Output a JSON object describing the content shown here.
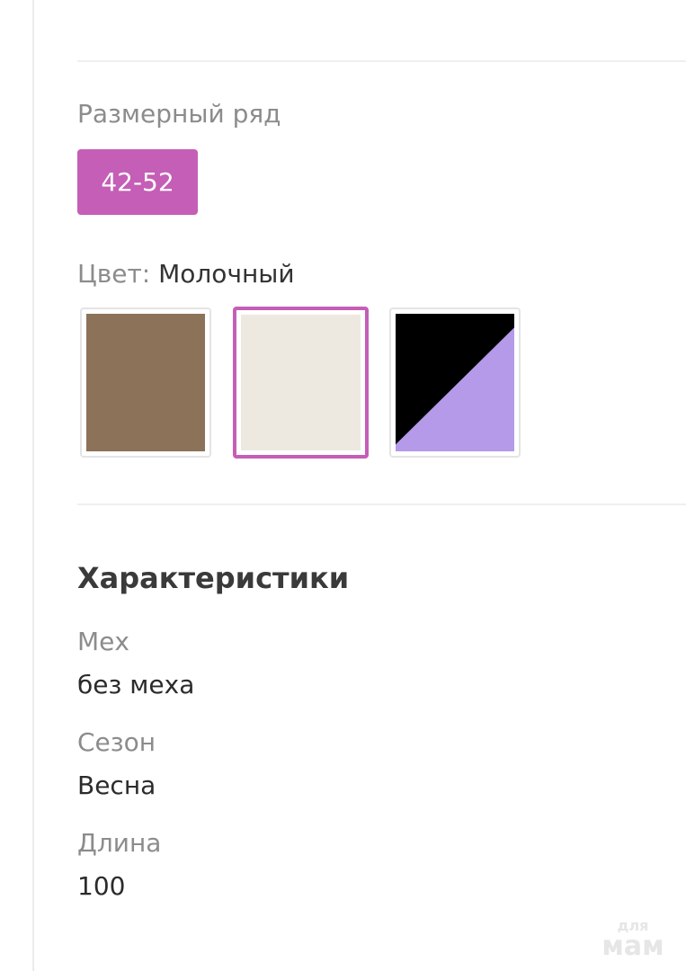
{
  "size_range": {
    "label": "Размерный ряд",
    "options": [
      "42-52"
    ],
    "selected": "42-52",
    "chip_color": "#c55eb6"
  },
  "color": {
    "label": "Цвет:",
    "selected_name": "Молочный",
    "swatches": [
      {
        "name": "brown",
        "fill": "#8c7258",
        "selected": false
      },
      {
        "name": "milk",
        "fill": "#ede9e0",
        "selected": true
      },
      {
        "name": "black-lilac",
        "fill_a": "#000000",
        "fill_b": "#b49ae9",
        "selected": false
      }
    ],
    "selection_border": "#c55eb6"
  },
  "characteristics": {
    "title": "Характеристики",
    "items": [
      {
        "name": "Мех",
        "value": "без меха"
      },
      {
        "name": "Сезон",
        "value": "Весна"
      },
      {
        "name": "Длина",
        "value": "100"
      }
    ]
  },
  "watermark": {
    "top": "для",
    "bottom": "мам"
  }
}
